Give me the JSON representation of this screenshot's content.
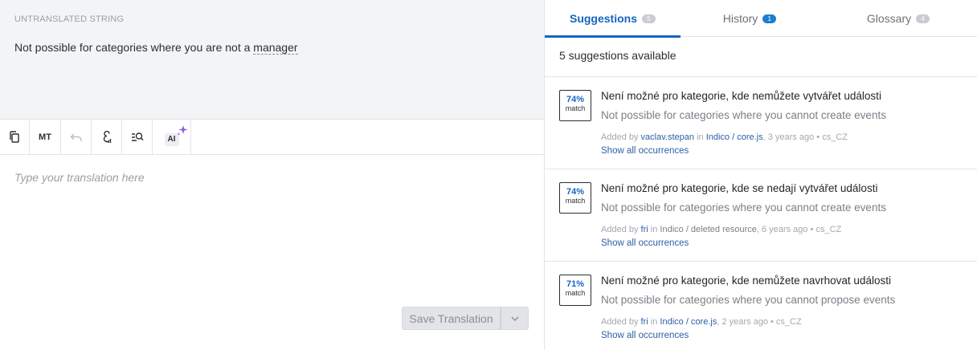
{
  "source": {
    "label": "UNTRANSLATED STRING",
    "text_before": "Not possible for categories where you are not a ",
    "glossary_term": "manager"
  },
  "toolbar": {
    "mt_label": "MT",
    "ai_label": "AI",
    "icons": [
      "copy-icon",
      "undo-icon",
      "special-characters-icon",
      "concordance-search-icon",
      "ai-sparkle-icon"
    ]
  },
  "translation": {
    "placeholder": "Type your translation here",
    "value": ""
  },
  "save": {
    "label": "Save Translation"
  },
  "tabs": [
    {
      "label": "Suggestions",
      "count": "5",
      "active": true
    },
    {
      "label": "History",
      "count": "1",
      "active": false
    },
    {
      "label": "Glossary",
      "count": "4",
      "active": false
    }
  ],
  "suggestions_summary": "5 suggestions available",
  "suggestions": [
    {
      "match_percent": "74%",
      "match_label": "match",
      "target": "Není možné pro kategorie, kde nemůžete vytvářet události",
      "source": "Not possible for categories where you cannot create events",
      "added_by_prefix": "Added by",
      "user": "vaclav.stepan",
      "in_word": "in",
      "resource": "Indico / core.js",
      "age": "3 years ago",
      "locale": "cs_CZ",
      "occurrences_link": "Show all occurrences"
    },
    {
      "match_percent": "74%",
      "match_label": "match",
      "target": "Není možné pro kategorie, kde se nedají vytvářet události",
      "source": "Not possible for categories where you cannot create events",
      "added_by_prefix": "Added by",
      "user": "fri",
      "in_word": "in",
      "resource": "Indico / deleted resource",
      "age": "6 years ago",
      "locale": "cs_CZ",
      "occurrences_link": "Show all occurrences"
    },
    {
      "match_percent": "71%",
      "match_label": "match",
      "target": "Není možné pro kategorie, kde nemůžete navrhovat události",
      "source": "Not possible for categories where you cannot propose events",
      "added_by_prefix": "Added by",
      "user": "fri",
      "in_word": "in",
      "resource": "Indico / core.js",
      "age": "2 years ago",
      "locale": "cs_CZ",
      "occurrences_link": "Show all occurrences"
    }
  ],
  "colors": {
    "accent": "#1565c0",
    "link": "#2d5fa8",
    "source_background": "#f3f4f6",
    "ai_sparkle": "#8e5fd6"
  }
}
